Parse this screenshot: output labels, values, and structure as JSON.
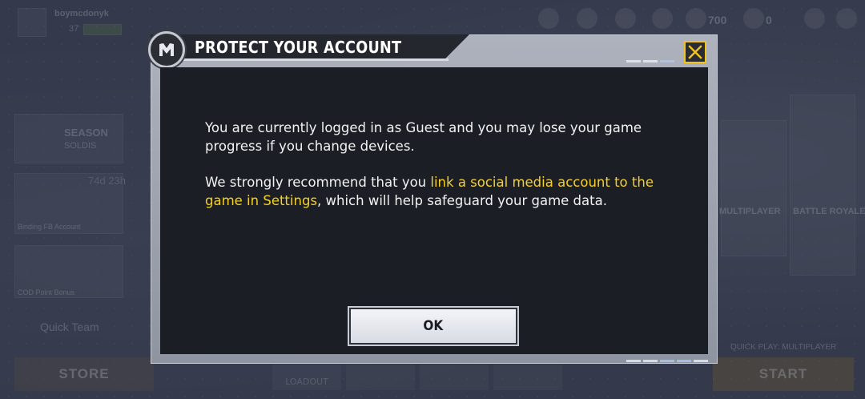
{
  "dialog": {
    "title": "PROTECT YOUR ACCOUNT",
    "message_1": "You are currently logged in as Guest and you may lose your game progress if you change devices.",
    "message_2_before": "We strongly recommend that you ",
    "message_2_link": "link a social media account to the game in Settings",
    "message_2_after": ", which will help safeguard your game data.",
    "ok_label": "OK",
    "accent_color": "#f5d028",
    "icons": {
      "logo": "codm-logo-icon",
      "close": "close-icon"
    }
  },
  "background": {
    "player_name": "boymcdonyk",
    "player_level": "37",
    "season_label": "SEASON",
    "season_sub": "SOLDIS",
    "timer": "74d 23h",
    "credits": "700",
    "cp": "0",
    "team_label": "Quick Team",
    "store_label": "STORE",
    "start_label": "START",
    "mode_multiplayer": "MULTIPLAYER",
    "mode_battle_royale": "BATTLE ROYALE",
    "quick_play_label": "QUICK PLAY: MULTIPLAYER",
    "loadout_label": "LOADOUT",
    "binding_label": "Binding FB Account",
    "point_label": "COD Point Bonus"
  }
}
